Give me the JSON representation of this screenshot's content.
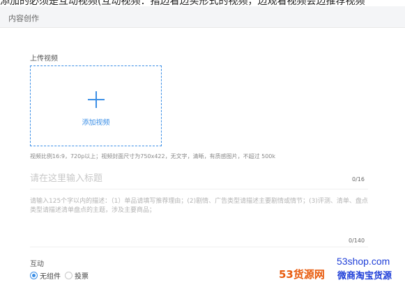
{
  "top_banner_text": "添加的必须是互动视频(互动视频：指边看边买形式的视频，边观看视频会边推荐视频",
  "header": {
    "breadcrumb": "内容创作"
  },
  "upload": {
    "section_label": "上传视频",
    "button_label": "添加视频",
    "hint": "视频比例16:9，720p以上；视频封面尺寸为750x422，无文字，清晰，有质感图片，不超过 500k"
  },
  "title_field": {
    "placeholder": "请在这里输入标题",
    "value": "",
    "counter": "0/16"
  },
  "description_field": {
    "placeholder": "请输入125个字以内的描述：（1）单品请填写推荐理由；(2)剧情、广告类型请描述主要剧情或情节；(3)评测、清单、盘点类型请描述清单盘点的主题，涉及主要商品；",
    "value": "",
    "counter": "0/140"
  },
  "interaction": {
    "section_label": "互动",
    "options": [
      {
        "label": "无组件",
        "checked": true
      },
      {
        "label": "投票",
        "checked": false
      }
    ]
  },
  "watermark": {
    "site": "53shop.com",
    "brand": "53货源网",
    "slogan": "微商淘宝货源"
  },
  "colors": {
    "accent": "#3a8ee6",
    "brand_orange": "#e85a0c",
    "brand_blue": "#1f3fd8"
  }
}
